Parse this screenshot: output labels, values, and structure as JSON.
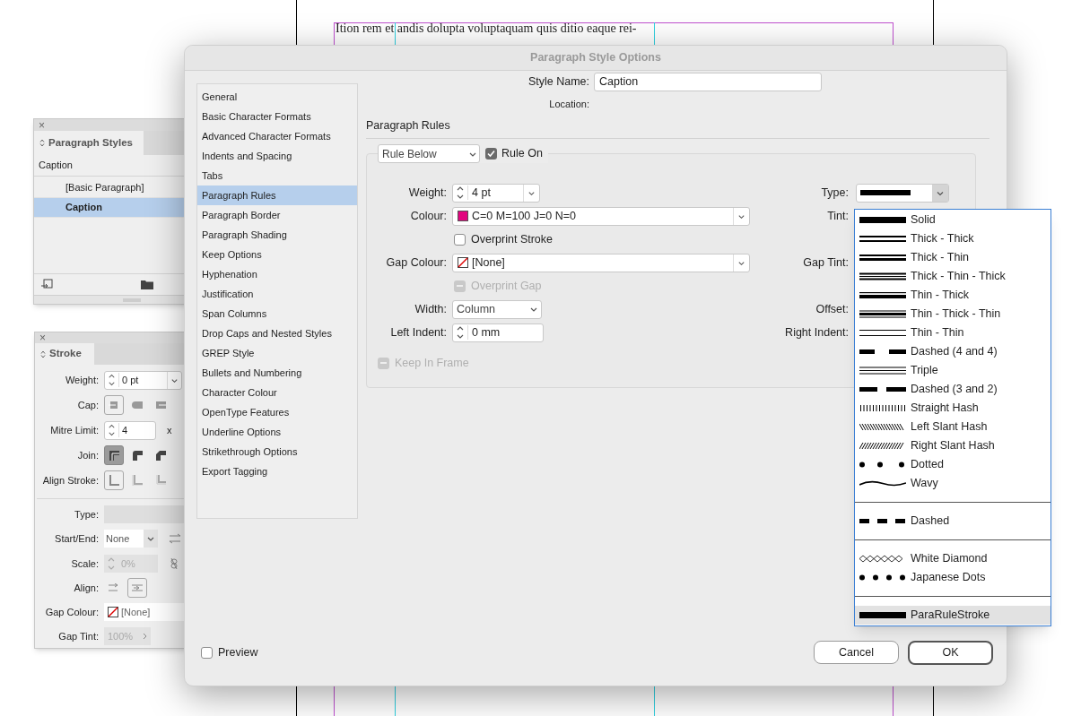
{
  "document": {
    "lines": [
      "Ition rem et andis dolupta voluptaquam quis ditio eaque rei-"
    ]
  },
  "paragraph_styles_panel": {
    "close": "×",
    "tab": "Paragraph Styles",
    "current": "Caption",
    "styles": [
      {
        "label": "[Basic Paragraph]",
        "selected": false
      },
      {
        "label": "Caption",
        "selected": true
      }
    ]
  },
  "stroke_panel": {
    "close": "×",
    "tab": "Stroke",
    "weight": {
      "label": "Weight:",
      "value": "0 pt"
    },
    "cap": {
      "label": "Cap:",
      "options": [
        {
          "selected": true
        },
        {
          "selected": false
        },
        {
          "selected": false
        }
      ]
    },
    "mitre_limit": {
      "label": "Mitre Limit:",
      "value": "4",
      "unit": "x"
    },
    "join": {
      "label": "Join:",
      "options": [
        {
          "selected": true
        },
        {
          "selected": false
        },
        {
          "selected": false
        }
      ]
    },
    "align_stroke": {
      "label": "Align Stroke:",
      "options": [
        {
          "selected": true
        },
        {
          "selected": false
        },
        {
          "selected": false
        }
      ]
    },
    "type": {
      "label": "Type:"
    },
    "start_end": {
      "label": "Start/End:",
      "value": "None"
    },
    "scale": {
      "label": "Scale:",
      "value": "0%",
      "disabled": true
    },
    "align": {
      "label": "Align:",
      "options": [
        {
          "selected": false
        },
        {
          "selected": true
        }
      ]
    },
    "gap_colour": {
      "label": "Gap Colour:",
      "value": "[None]"
    },
    "gap_tint": {
      "label": "Gap Tint:",
      "value": "100%",
      "disabled": true
    }
  },
  "dialog": {
    "title": "Paragraph Style Options",
    "nav": [
      {
        "label": "General",
        "selected": false
      },
      {
        "label": "Basic Character Formats",
        "selected": false
      },
      {
        "label": "Advanced Character Formats",
        "selected": false
      },
      {
        "label": "Indents and Spacing",
        "selected": false
      },
      {
        "label": "Tabs",
        "selected": false
      },
      {
        "label": "Paragraph Rules",
        "selected": true
      },
      {
        "label": "Paragraph Border",
        "selected": false
      },
      {
        "label": "Paragraph Shading",
        "selected": false
      },
      {
        "label": "Keep Options",
        "selected": false
      },
      {
        "label": "Hyphenation",
        "selected": false
      },
      {
        "label": "Justification",
        "selected": false
      },
      {
        "label": "Span Columns",
        "selected": false
      },
      {
        "label": "Drop Caps and Nested Styles",
        "selected": false
      },
      {
        "label": "GREP Style",
        "selected": false
      },
      {
        "label": "Bullets and Numbering",
        "selected": false
      },
      {
        "label": "Character Colour",
        "selected": false
      },
      {
        "label": "OpenType Features",
        "selected": false
      },
      {
        "label": "Underline Options",
        "selected": false
      },
      {
        "label": "Strikethrough Options",
        "selected": false
      },
      {
        "label": "Export Tagging",
        "selected": false
      }
    ],
    "style_name": {
      "label": "Style Name:",
      "value": "Caption"
    },
    "location": {
      "label": "Location:"
    },
    "section_title": "Paragraph Rules",
    "rule_select": "Rule Below",
    "rule_on": {
      "label": "Rule On",
      "checked": true
    },
    "weight": {
      "label": "Weight:",
      "value": "4 pt"
    },
    "colour": {
      "label": "Colour:",
      "value": "C=0 M=100 J=0 N=0",
      "color": "#e2067f"
    },
    "overprint_stroke": {
      "label": "Overprint Stroke",
      "checked": false,
      "disabled": false
    },
    "gap_colour": {
      "label": "Gap Colour:",
      "value": "[None]"
    },
    "overprint_gap": {
      "label": "Overprint Gap",
      "checked": false,
      "disabled": true
    },
    "width": {
      "label": "Width:",
      "value": "Column"
    },
    "left_indent": {
      "label": "Left Indent:",
      "value": "0 mm"
    },
    "keep_in_frame": {
      "label": "Keep In Frame",
      "checked": false,
      "disabled": true
    },
    "right_labels": {
      "type": "Type:",
      "tint": "Tint:",
      "gap_tint": "Gap Tint:",
      "offset": "Offset:",
      "right_indent": "Right Indent:"
    },
    "preview": {
      "label": "Preview",
      "checked": false
    },
    "buttons": [
      {
        "label": "Cancel",
        "kind": "secondary"
      },
      {
        "label": "OK",
        "kind": "default"
      }
    ]
  },
  "type_menu": {
    "groups": [
      [
        {
          "label": "Solid",
          "kind": "solid",
          "selected": false
        },
        {
          "label": "Thick - Thick",
          "kind": "thick_thick",
          "selected": false
        },
        {
          "label": "Thick - Thin",
          "kind": "thick_thin",
          "selected": false
        },
        {
          "label": "Thick - Thin - Thick",
          "kind": "thick_thin_thick",
          "selected": false
        },
        {
          "label": "Thin - Thick",
          "kind": "thin_thick",
          "selected": false
        },
        {
          "label": "Thin - Thick - Thin",
          "kind": "thin_thick_thin",
          "selected": false
        },
        {
          "label": "Thin - Thin",
          "kind": "thin_thin",
          "selected": false
        },
        {
          "label": "Dashed (4 and 4)",
          "kind": "dashed_4_4",
          "selected": false
        },
        {
          "label": "Triple",
          "kind": "triple",
          "selected": false
        },
        {
          "label": "Dashed (3 and 2)",
          "kind": "dashed_3_2",
          "selected": false
        },
        {
          "label": "Straight Hash",
          "kind": "straight_hash",
          "selected": false
        },
        {
          "label": "Left Slant Hash",
          "kind": "left_slant_hash",
          "selected": false
        },
        {
          "label": "Right Slant Hash",
          "kind": "right_slant_hash",
          "selected": false
        },
        {
          "label": "Dotted",
          "kind": "dotted",
          "selected": false
        },
        {
          "label": "Wavy",
          "kind": "wavy",
          "selected": false
        }
      ],
      [
        {
          "label": "Dashed",
          "kind": "dashed",
          "selected": false
        }
      ],
      [
        {
          "label": "White Diamond",
          "kind": "white_diamond",
          "selected": false
        },
        {
          "label": "Japanese Dots",
          "kind": "japanese_dots",
          "selected": false
        }
      ],
      [
        {
          "label": "ParaRuleStroke",
          "kind": "solid",
          "selected": true
        }
      ]
    ]
  }
}
